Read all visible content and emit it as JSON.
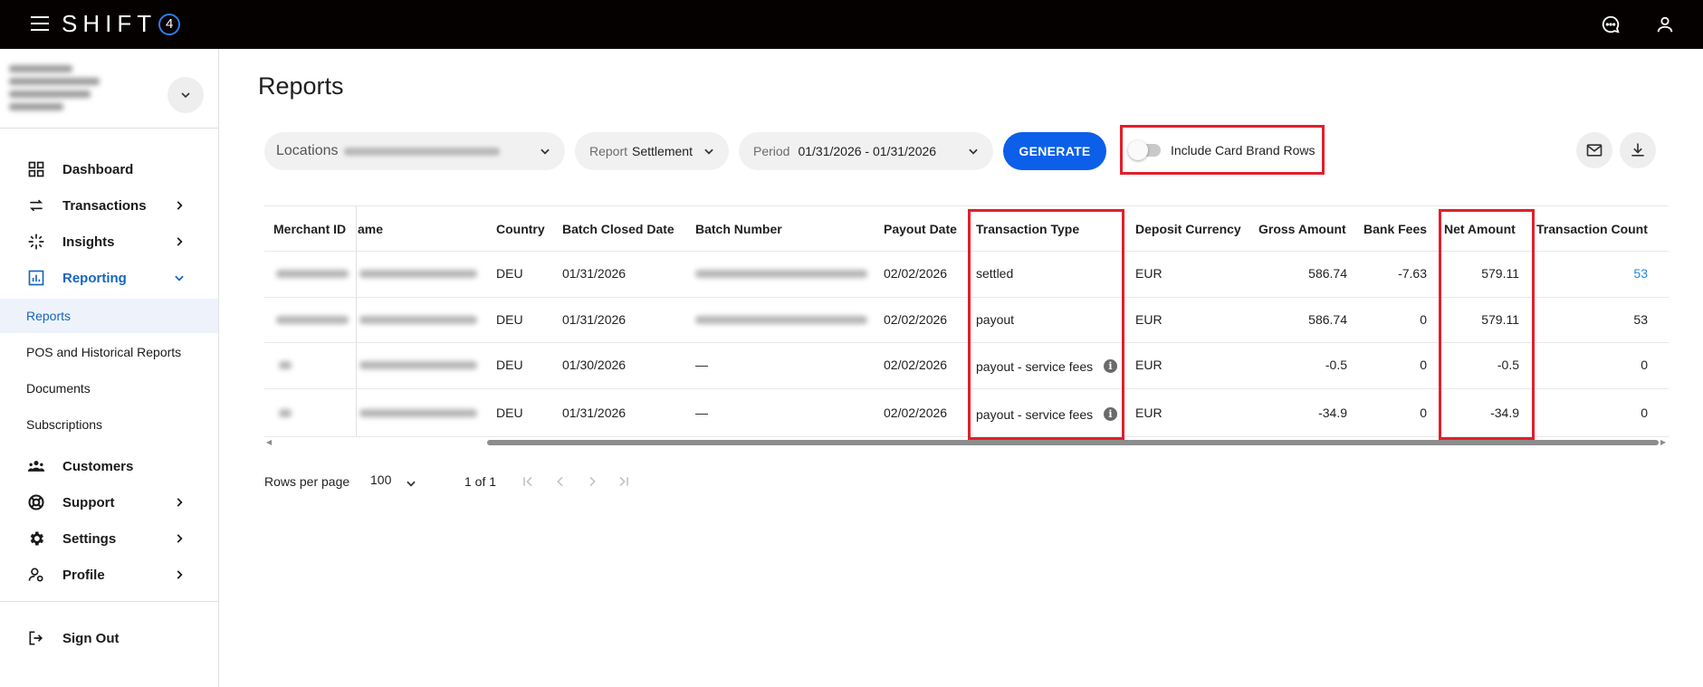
{
  "app": {
    "brand": "SHIFT",
    "brand_badge": "4"
  },
  "topbar": {
    "icons": [
      "menu-icon",
      "chat-icon",
      "user-icon"
    ]
  },
  "sidebar": {
    "items": [
      {
        "label": "Dashboard",
        "icon": "dashboard-grid-icon"
      },
      {
        "label": "Transactions",
        "icon": "transfer-arrows-icon"
      },
      {
        "label": "Insights",
        "icon": "sparkle-icon"
      },
      {
        "label": "Reporting",
        "icon": "bar-chart-icon"
      }
    ],
    "subitems": [
      {
        "label": "Reports"
      },
      {
        "label": "POS and Historical Reports"
      },
      {
        "label": "Documents"
      },
      {
        "label": "Subscriptions"
      }
    ],
    "items2": [
      {
        "label": "Customers",
        "icon": "people-icon"
      },
      {
        "label": "Support",
        "icon": "lifebuoy-icon"
      },
      {
        "label": "Settings",
        "icon": "gear-icon"
      },
      {
        "label": "Profile",
        "icon": "user-gear-icon"
      }
    ],
    "signout": {
      "label": "Sign Out",
      "icon": "logout-icon"
    }
  },
  "page": {
    "title": "Reports"
  },
  "filters": {
    "locations_label": "Locations",
    "report_label": "Report",
    "report_value": "Settlement",
    "period_label": "Period",
    "period_value": "01/31/2026 - 01/31/2026",
    "generate_label": "GENERATE",
    "toggle_label": "Include Card Brand Rows",
    "toggle_on": false
  },
  "table": {
    "headers": [
      "Merchant ID",
      "ame",
      "Country",
      "Batch Closed Date",
      "Batch Number",
      "Payout Date",
      "Transaction Type",
      "Deposit Currency",
      "Gross Amount",
      "Bank Fees",
      "Net Amount",
      "Transaction Count"
    ],
    "rows": [
      {
        "merchant_id": "",
        "name": "",
        "country": "DEU",
        "batch_closed": "01/31/2026",
        "batch_number": "",
        "payout_date": "02/02/2026",
        "type": "settled",
        "currency": "EUR",
        "gross": "586.74",
        "fees": "-7.63",
        "net": "579.11",
        "count": "53"
      },
      {
        "merchant_id": "",
        "name": "",
        "country": "DEU",
        "batch_closed": "01/31/2026",
        "batch_number": "",
        "payout_date": "02/02/2026",
        "type": "payout",
        "currency": "EUR",
        "gross": "586.74",
        "fees": "0",
        "net": "579.11",
        "count": "53"
      },
      {
        "merchant_id": "",
        "name": "",
        "country": "DEU",
        "batch_closed": "01/30/2026",
        "batch_number": "—",
        "payout_date": "02/02/2026",
        "type": "payout - service fees",
        "currency": "EUR",
        "gross": "-0.5",
        "fees": "0",
        "net": "-0.5",
        "count": "0"
      },
      {
        "merchant_id": "",
        "name": "",
        "country": "DEU",
        "batch_closed": "01/31/2026",
        "batch_number": "—",
        "payout_date": "02/02/2026",
        "type": "payout - service fees",
        "currency": "EUR",
        "gross": "-34.9",
        "fees": "0",
        "net": "-34.9",
        "count": "0"
      }
    ]
  },
  "pagination": {
    "rows_per_page_label": "Rows per page",
    "rows_per_page": "100",
    "page_info": "1 of 1"
  },
  "colors": {
    "accent": "#0b5fe8",
    "highlight": "#e0202a",
    "topbar": "#050101",
    "link": "#1e88e5"
  }
}
